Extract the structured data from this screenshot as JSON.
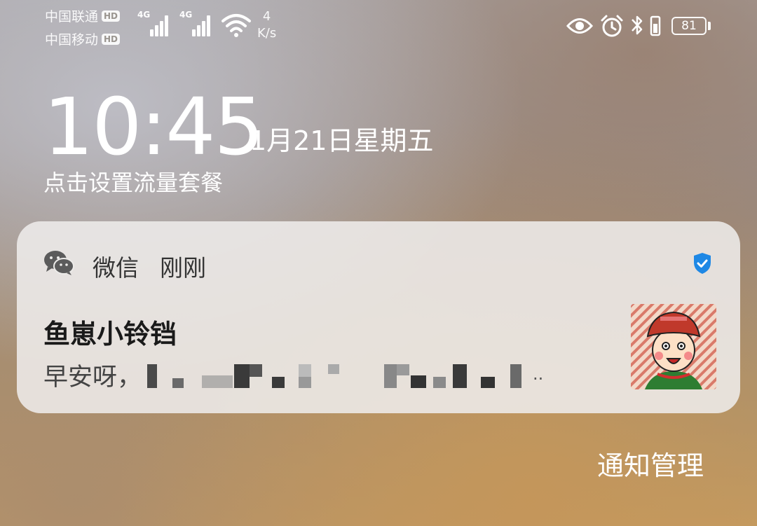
{
  "status_bar": {
    "carrier_1": "中国联通",
    "carrier_2": "中国移动",
    "hd_badge": "HD",
    "signal_1_type": "4G",
    "signal_2_type": "4G",
    "speed_value": "4",
    "speed_unit": "K/s",
    "battery_level": "81",
    "icons": [
      "eye-icon",
      "alarm-icon",
      "bluetooth-icon",
      "vibrate-icon",
      "battery-icon"
    ]
  },
  "lockscreen": {
    "time": "10:45",
    "date": "1月21日星期五",
    "plan_hint": "点击设置流量套餐"
  },
  "notification": {
    "app_name": "微信",
    "time_label": "刚刚",
    "sender": "鱼崽小铃铛",
    "message_prefix": "早安呀，",
    "message_tail": "..",
    "accent_color": "#1e88e5"
  },
  "footer": {
    "manage_label": "通知管理"
  }
}
